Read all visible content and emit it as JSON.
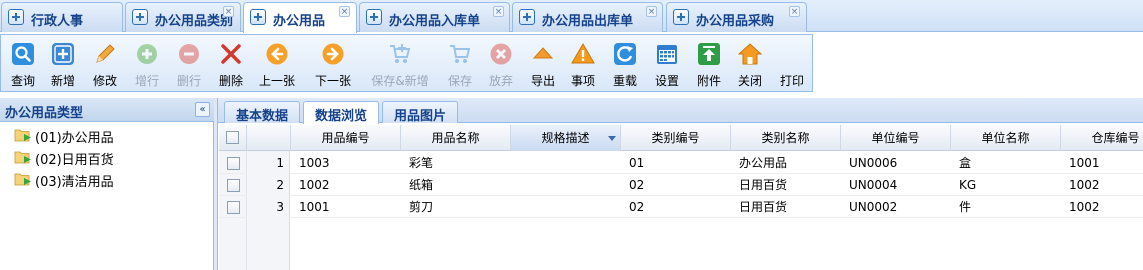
{
  "top_tabs": [
    {
      "label": "行政人事",
      "active": false,
      "closable": false
    },
    {
      "label": "办公用品类别",
      "active": false,
      "closable": true
    },
    {
      "label": "办公用品",
      "active": true,
      "closable": true
    },
    {
      "label": "办公用品入库单",
      "active": false,
      "closable": true
    },
    {
      "label": "办公用品出库单",
      "active": false,
      "closable": true
    },
    {
      "label": "办公用品采购",
      "active": false,
      "closable": true
    }
  ],
  "close_glyph": "×",
  "toolbar": {
    "buttons": [
      {
        "label": "查询",
        "icon": "search-icon",
        "enabled": true
      },
      {
        "label": "新增",
        "icon": "add-icon",
        "enabled": true
      },
      {
        "label": "修改",
        "icon": "pencil-icon",
        "enabled": true
      },
      {
        "label": "增行",
        "icon": "plus-circle-icon",
        "enabled": false
      },
      {
        "label": "删行",
        "icon": "minus-circle-icon",
        "enabled": false
      },
      {
        "label": "删除",
        "icon": "delete-x-icon",
        "enabled": true
      },
      {
        "label": "上一张",
        "icon": "arrow-left-icon",
        "enabled": true
      },
      {
        "label": "下一张",
        "icon": "arrow-right-icon",
        "enabled": true
      },
      {
        "label": "保存&新增",
        "icon": "cart-add-icon",
        "enabled": false
      },
      {
        "label": "保存",
        "icon": "cart-save-icon",
        "enabled": false
      },
      {
        "label": "放弃",
        "icon": "cancel-icon",
        "enabled": false
      },
      {
        "label": "导出",
        "icon": "export-icon",
        "enabled": true
      },
      {
        "label": "事项",
        "icon": "warning-icon",
        "enabled": true
      },
      {
        "label": "重载",
        "icon": "reload-icon",
        "enabled": true
      },
      {
        "label": "设置",
        "icon": "calendar-settings-icon",
        "enabled": true
      },
      {
        "label": "附件",
        "icon": "attachment-upload-icon",
        "enabled": true
      },
      {
        "label": "关闭",
        "icon": "home-close-icon",
        "enabled": true
      },
      {
        "label": "打印",
        "icon": "print-icon",
        "enabled": true
      }
    ]
  },
  "left_panel": {
    "title": "办公用品类型",
    "collapse_glyph": "«",
    "tree": [
      {
        "label": "(01)办公用品"
      },
      {
        "label": "(02)日用百货"
      },
      {
        "label": "(03)清洁用品"
      }
    ]
  },
  "sub_tabs": [
    {
      "label": "基本数据",
      "active": false
    },
    {
      "label": "数据浏览",
      "active": true
    },
    {
      "label": "用品图片",
      "active": false
    }
  ],
  "grid": {
    "columns": [
      "用品编号",
      "用品名称",
      "规格描述",
      "类别编号",
      "类别名称",
      "单位编号",
      "单位名称",
      "仓库编号"
    ],
    "sorted_column": "规格描述",
    "rows": [
      {
        "rownum": "1",
        "cells": [
          "1003",
          "彩笔",
          "",
          "01",
          "办公用品",
          "UN0006",
          "盒",
          "1001"
        ]
      },
      {
        "rownum": "2",
        "cells": [
          "1002",
          "纸箱",
          "",
          "02",
          "日用百货",
          "UN0004",
          "KG",
          "1002"
        ]
      },
      {
        "rownum": "3",
        "cells": [
          "1001",
          "剪刀",
          "",
          "02",
          "日用百货",
          "UN0002",
          "件",
          "1002"
        ]
      }
    ]
  },
  "colors": {
    "header_text": "#15428b",
    "border": "#99bbe8",
    "disabled_text": "#9ba7b8"
  }
}
